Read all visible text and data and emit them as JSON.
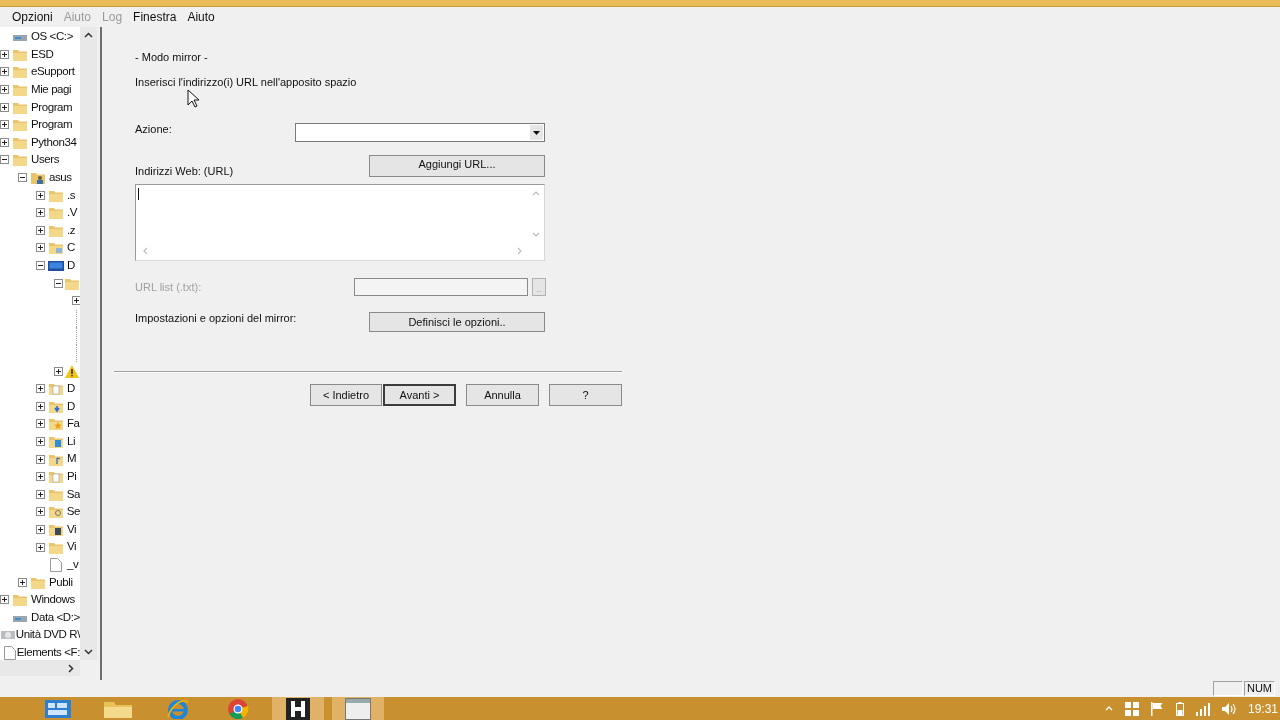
{
  "menu": [
    {
      "label": "Opzioni",
      "disabled": false
    },
    {
      "label": "Aiuto",
      "disabled": true
    },
    {
      "label": "Log",
      "disabled": true
    },
    {
      "label": "Finestra",
      "disabled": false
    },
    {
      "label": "Aiuto",
      "disabled": false
    }
  ],
  "tree": [
    {
      "label": "OS <C:>",
      "kind": "drive",
      "children": [
        {
          "label": "ESD",
          "kind": "folder",
          "expanded": false
        },
        {
          "label": "eSupport",
          "kind": "folder",
          "expanded": false
        },
        {
          "label": "Mie pagi",
          "kind": "folder",
          "expanded": false
        },
        {
          "label": "Program",
          "kind": "folder",
          "expanded": false
        },
        {
          "label": "Program",
          "kind": "folder",
          "expanded": false
        },
        {
          "label": "Python34",
          "kind": "folder",
          "expanded": false
        },
        {
          "label": "Users",
          "kind": "folder",
          "expanded": true,
          "children": [
            {
              "label": "asus",
              "kind": "user",
              "expanded": true,
              "children": [
                {
                  "label": ".s",
                  "kind": "folder",
                  "expanded": false
                },
                {
                  "label": ".V",
                  "kind": "folder",
                  "expanded": false
                },
                {
                  "label": ".z",
                  "kind": "folder",
                  "expanded": false
                },
                {
                  "label": "C",
                  "kind": "contacts",
                  "expanded": false
                },
                {
                  "label": "D",
                  "kind": "desktop",
                  "expanded": true,
                  "children": [
                    {
                      "kind": "folder",
                      "expanded": true,
                      "children": [
                        {
                          "kind": "blank",
                          "expanded": false
                        },
                        {
                          "kind": "line"
                        },
                        {
                          "kind": "line"
                        },
                        {
                          "kind": "line"
                        }
                      ]
                    },
                    {
                      "kind": "warning",
                      "expanded": false
                    }
                  ]
                },
                {
                  "label": "D",
                  "kind": "document",
                  "expanded": false
                },
                {
                  "label": "D",
                  "kind": "download",
                  "expanded": false
                },
                {
                  "label": "Fa",
                  "kind": "star",
                  "expanded": false
                },
                {
                  "label": "Li",
                  "kind": "link",
                  "expanded": false
                },
                {
                  "label": "M",
                  "kind": "music",
                  "expanded": false
                },
                {
                  "label": "Pi",
                  "kind": "document",
                  "expanded": false
                },
                {
                  "label": "Sa",
                  "kind": "folder",
                  "expanded": false
                },
                {
                  "label": "Se",
                  "kind": "search",
                  "expanded": false
                },
                {
                  "label": "Vi",
                  "kind": "video",
                  "expanded": false
                },
                {
                  "label": "Vi",
                  "kind": "folder",
                  "expanded": false
                },
                {
                  "label": "_v",
                  "kind": "file"
                }
              ]
            },
            {
              "label": "Publi",
              "kind": "folder",
              "expanded": false
            }
          ]
        },
        {
          "label": "Windows",
          "kind": "folder",
          "expanded": false
        }
      ]
    },
    {
      "label": "Data <D:>",
      "kind": "drive"
    },
    {
      "label": "Unità DVD R\\",
      "kind": "dvd"
    },
    {
      "label": "Elements <F:",
      "kind": "file"
    }
  ],
  "dialog": {
    "heading": "- Modo mirror -",
    "instruction": "Inserisci l'indirizzo(i) URL nell'apposito spazio",
    "action": {
      "label": "Azione:"
    },
    "urls": {
      "label": "Indirizzi Web: (URL)",
      "button": "Aggiungi URL..."
    },
    "url_list": {
      "label": "URL list (.txt):",
      "disabled": true,
      "browse": ".."
    },
    "options": {
      "label": "Impostazioni e opzioni del mirror:",
      "button": "Definisci le opzioni.."
    },
    "buttons": [
      {
        "label": "< Indietro",
        "default": false
      },
      {
        "label": "Avanti >",
        "default": true
      },
      {
        "label": "Annulla",
        "default": false
      },
      {
        "label": "?",
        "default": false
      }
    ]
  },
  "status_bar": {
    "indicator": "NUM"
  },
  "taskbar": {
    "apps": [
      {
        "kind": "tiles",
        "active": false
      },
      {
        "kind": "explorer",
        "active": false
      },
      {
        "kind": "ie",
        "active": false
      },
      {
        "kind": "chrome",
        "active": false
      },
      {
        "kind": "httrack",
        "active": true
      },
      {
        "kind": "window",
        "active": true
      }
    ],
    "clock": "19:31"
  }
}
